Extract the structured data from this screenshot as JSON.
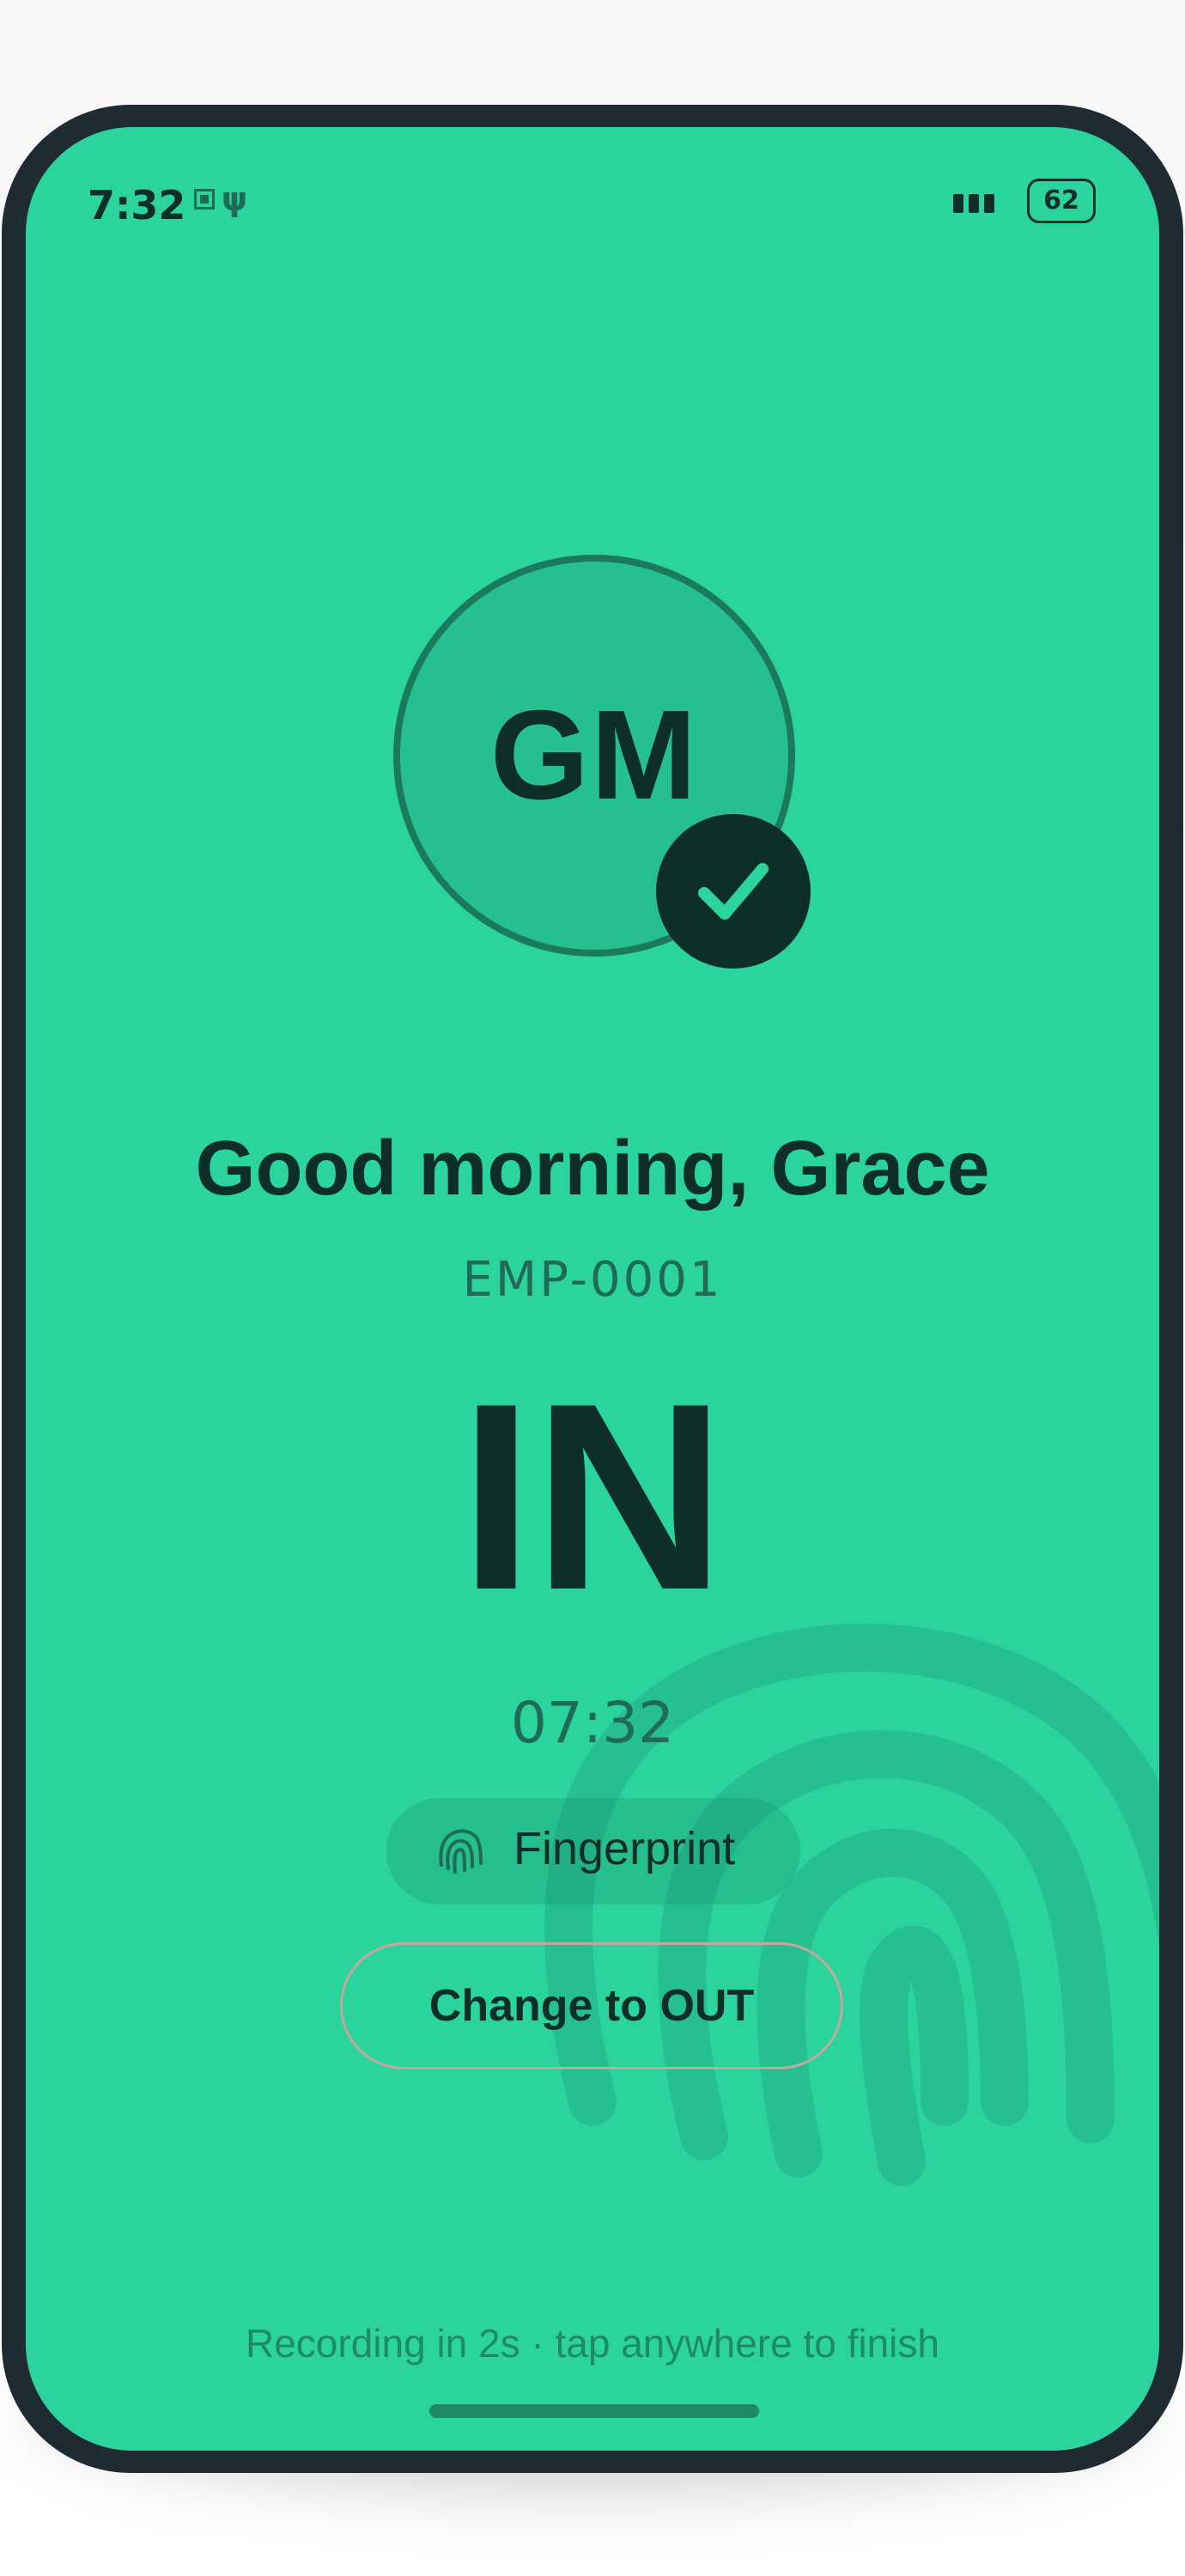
{
  "status_bar": {
    "time": "7:32",
    "usb_glyph": "ψ",
    "battery": "62",
    "icons": [
      "sim-icon",
      "usb-icon",
      "signal-icon",
      "battery-icon"
    ]
  },
  "employee": {
    "initials": "GM",
    "greeting": "Good morning, Grace",
    "id": "EMP-0001"
  },
  "clock": {
    "status": "IN",
    "time": "07:32",
    "method": "Fingerprint",
    "method_icon": "fingerprint-icon",
    "change_label": "Change to OUT"
  },
  "footer": {
    "hint": "Recording in 2s · tap anywhere to finish"
  },
  "colors": {
    "screen_bg": "#2bd49d",
    "frame": "#1e2b33",
    "text_dark": "#0e2f28",
    "text_muted": "#1f6b55"
  }
}
